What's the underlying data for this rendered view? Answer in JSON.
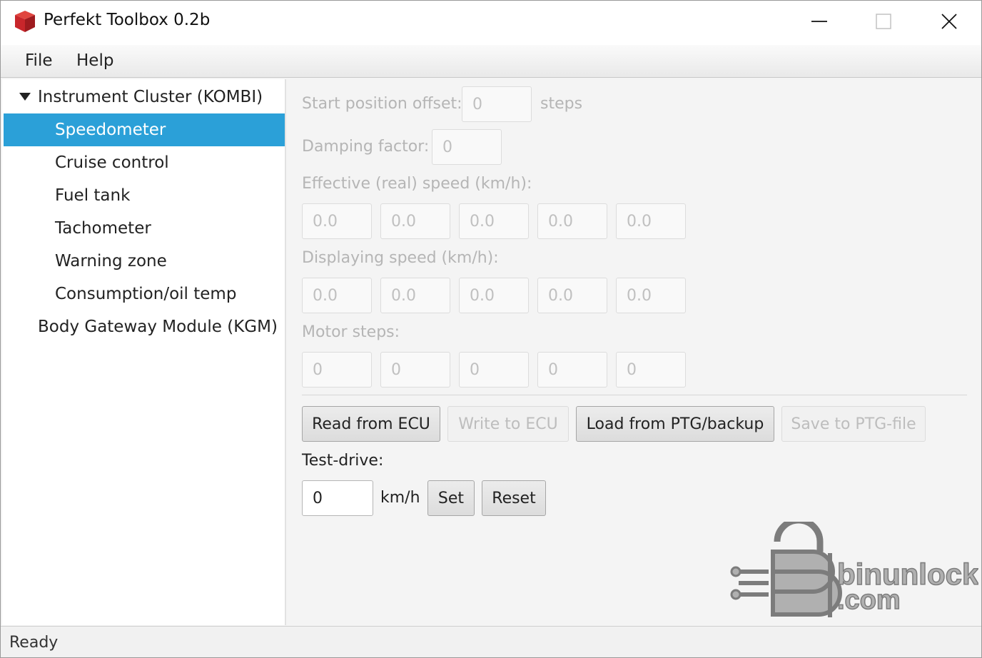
{
  "window": {
    "title": "Perfekt Toolbox 0.2b",
    "app_icon": "red-cube-icon",
    "controls": [
      "minimize-icon",
      "maximize-icon",
      "close-icon"
    ]
  },
  "menu": {
    "file_label": "File",
    "help_label": "Help"
  },
  "sidebar": {
    "root_group_label": "Instrument Cluster (KOMBI)",
    "items": [
      {
        "label": "Speedometer",
        "selected": true
      },
      {
        "label": "Cruise control"
      },
      {
        "label": "Fuel tank"
      },
      {
        "label": "Tachometer"
      },
      {
        "label": "Warning zone"
      },
      {
        "label": "Consumption/oil temp"
      }
    ],
    "second_group_label": "Body Gateway Module (KGM)"
  },
  "main": {
    "start_offset": {
      "label": "Start position offset:",
      "value": "0",
      "unit": "steps"
    },
    "damping": {
      "label": "Damping factor:",
      "value": "0"
    },
    "effective_speed": {
      "label": "Effective (real) speed (km/h):",
      "values": [
        "0.0",
        "0.0",
        "0.0",
        "0.0",
        "0.0"
      ]
    },
    "displaying_speed": {
      "label": "Displaying speed (km/h):",
      "values": [
        "0.0",
        "0.0",
        "0.0",
        "0.0",
        "0.0"
      ]
    },
    "motor_steps": {
      "label": "Motor steps:",
      "values": [
        "0",
        "0",
        "0",
        "0",
        "0"
      ]
    },
    "buttons": {
      "read": "Read from ECU",
      "write": "Write to ECU",
      "load": "Load from PTG/backup",
      "save": "Save to PTG-file"
    },
    "test_drive": {
      "label": "Test-drive:",
      "value": "0",
      "unit": "km/h",
      "set_label": "Set",
      "reset_label": "Reset"
    }
  },
  "watermark": {
    "text_line1": "binunlock",
    "text_line2": ".com"
  },
  "status": {
    "text": "Ready"
  },
  "colors": {
    "selection": "#2ba0d8",
    "app_icon": "#c8262b"
  }
}
